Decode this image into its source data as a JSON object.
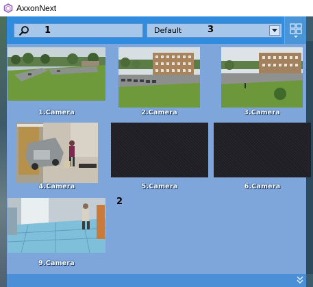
{
  "window": {
    "title": "AxxonNext"
  },
  "toolbar": {
    "search_value": "1",
    "layout_selected": "Default",
    "layout_badge": "3"
  },
  "area_badge": "2",
  "cameras": [
    {
      "label": "1.Camera",
      "feed": "live"
    },
    {
      "label": "2.Camera",
      "feed": "live"
    },
    {
      "label": "3.Camera",
      "feed": "live"
    },
    {
      "label": "4.Camera",
      "feed": "live"
    },
    {
      "label": "5.Camera",
      "feed": "no-signal"
    },
    {
      "label": "6.Camera",
      "feed": "no-signal"
    },
    {
      "label": "9.Camera",
      "feed": "live"
    }
  ],
  "icons": {
    "app": "axxon-logo-icon",
    "search": "search-icon",
    "dropdown": "chevron-down-icon",
    "layouts": "grid-layout-icon",
    "expand": "double-chevron-down-icon"
  },
  "colors": {
    "toolbar": "#2f8cdf",
    "panel": "#7fa6da",
    "label": "#ffffff"
  }
}
